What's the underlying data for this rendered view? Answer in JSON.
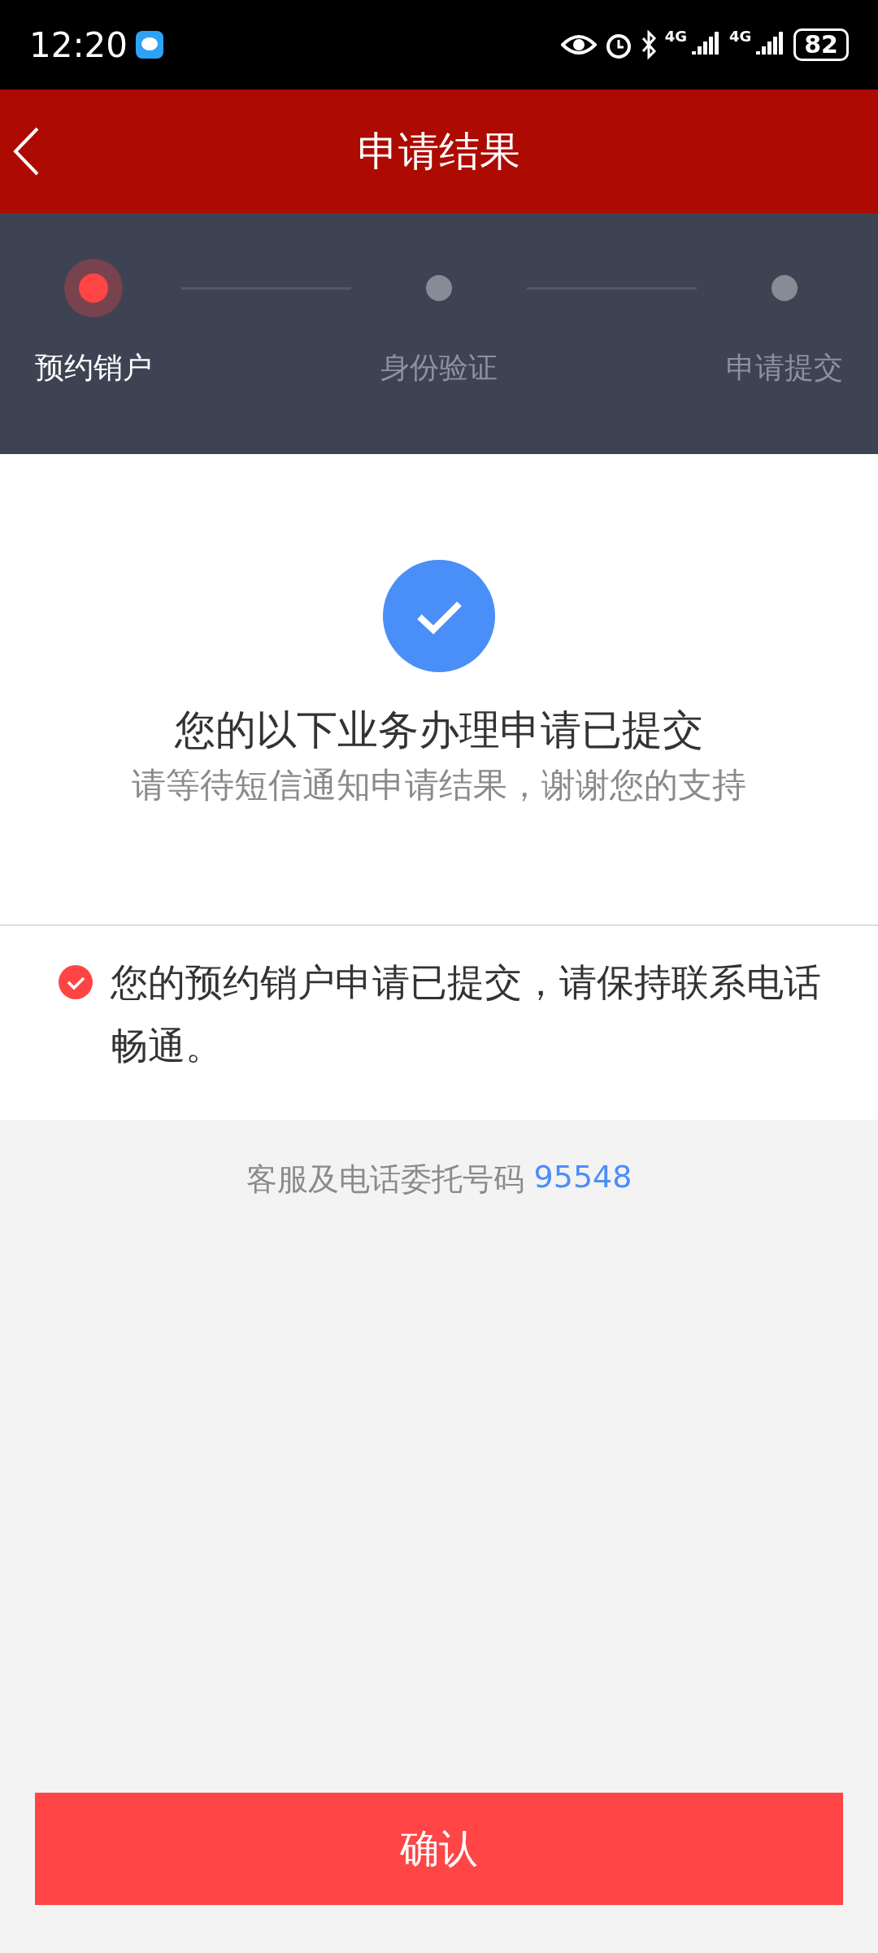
{
  "status_bar": {
    "time": "12:20",
    "network": [
      "4G",
      "4G"
    ],
    "battery": "82"
  },
  "header": {
    "title": "申请结果"
  },
  "steps": [
    {
      "label": "预约销户",
      "selected": true
    },
    {
      "label": "身份验证",
      "selected": false
    },
    {
      "label": "申请提交",
      "selected": false
    }
  ],
  "result": {
    "title": "您的以下业务办理申请已提交",
    "subtitle": "请等待短信通知申请结果，谢谢您的支持"
  },
  "notices": [
    {
      "text": "您的预约销户申请已提交，请保持联系电话畅通。"
    }
  ],
  "footer": {
    "label": "客服及电话委托号码",
    "phone": "95548"
  },
  "confirm_button": "确认"
}
